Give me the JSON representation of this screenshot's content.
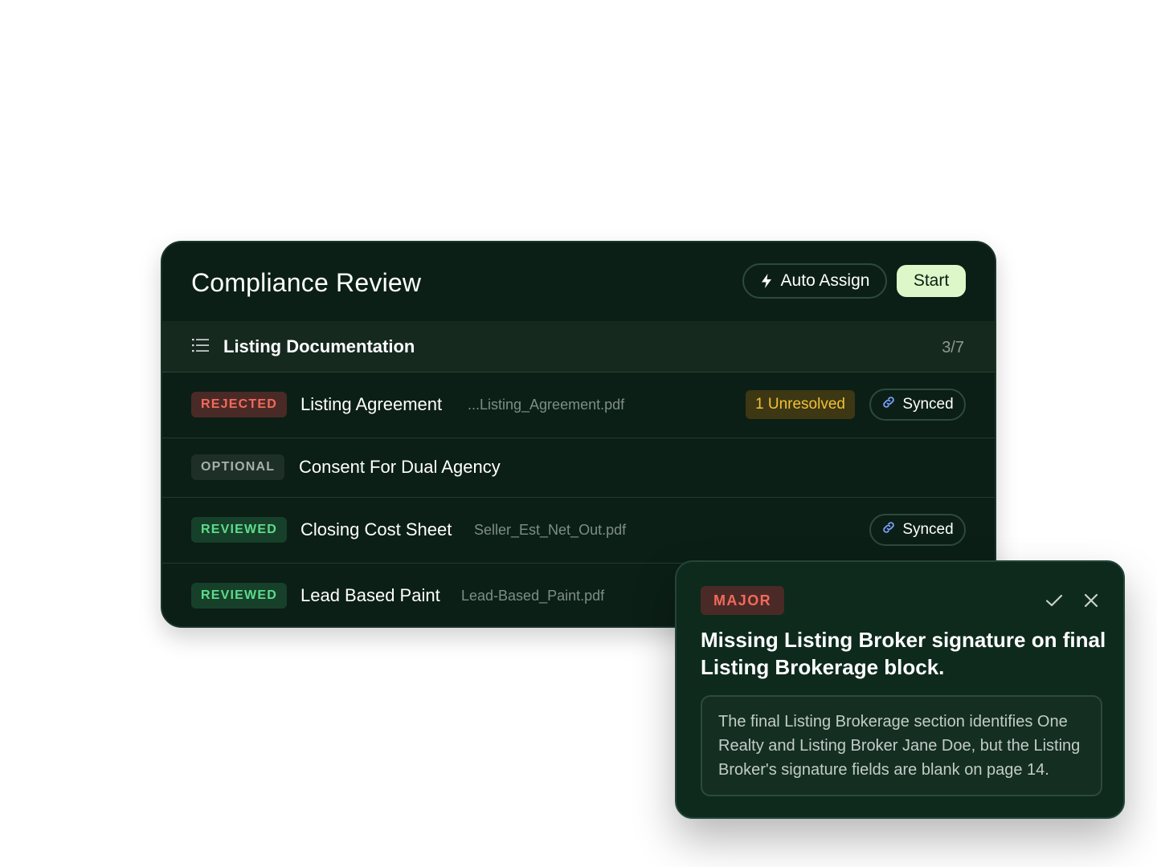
{
  "panel": {
    "title": "Compliance Review",
    "auto_assign_label": "Auto Assign",
    "start_label": "Start"
  },
  "section": {
    "title": "Listing Documentation",
    "count": "3/7"
  },
  "documents": [
    {
      "status": "REJECTED",
      "name": "Listing Agreement",
      "file": "...Listing_Agreement.pdf",
      "unresolved": "1 Unresolved",
      "sync": "Synced"
    },
    {
      "status": "OPTIONAL",
      "name": "Consent For Dual Agency"
    },
    {
      "status": "REVIEWED",
      "name": "Closing Cost Sheet",
      "file": "Seller_Est_Net_Out.pdf",
      "sync": "Synced"
    },
    {
      "status": "REVIEWED",
      "name": "Lead Based Paint",
      "file": "Lead-Based_Paint.pdf"
    }
  ],
  "issue": {
    "severity": "MAJOR",
    "title": "Missing Listing Broker signature on final Listing Brokerage block.",
    "description": "The final Listing Brokerage section identifies One Realty and Listing Broker Jane Doe, but the Listing Broker's signature fields are blank on page 14."
  },
  "colors": {
    "panel_bg": "#0b1f16",
    "accent_start": "#def7c9",
    "rejected": "#f26a5c",
    "reviewed": "#5ddc8a",
    "unresolved": "#f1c232",
    "link_icon": "#7aa2ff"
  },
  "icons": {
    "auto_assign": "lightning-icon",
    "section": "list-icon",
    "sync": "link-icon",
    "accept": "check-icon",
    "dismiss": "close-icon"
  }
}
